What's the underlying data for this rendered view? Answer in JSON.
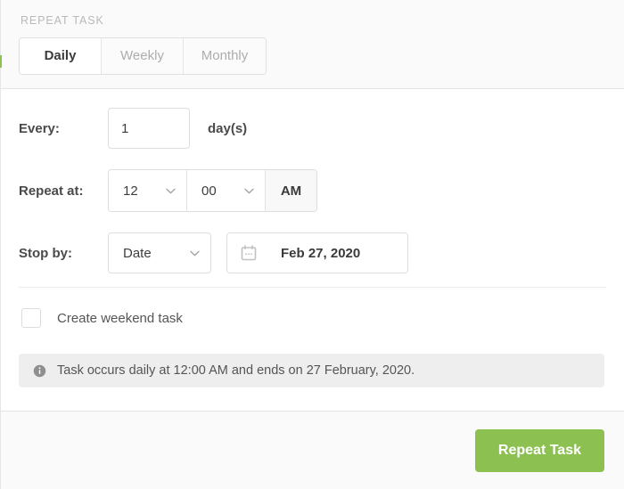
{
  "header": {
    "title": "REPEAT TASK",
    "tabs": [
      {
        "label": "Daily",
        "active": true
      },
      {
        "label": "Weekly",
        "active": false
      },
      {
        "label": "Monthly",
        "active": false
      }
    ]
  },
  "form": {
    "every": {
      "label": "Every:",
      "value": "1",
      "placeholder": "1",
      "suffix": "day(s)"
    },
    "repeat_at": {
      "label": "Repeat at:",
      "hour": "12",
      "minute": "00",
      "meridiem": "AM"
    },
    "stop_by": {
      "label": "Stop by:",
      "mode": "Date",
      "date": "Feb 27, 2020"
    },
    "weekend_task": {
      "label": "Create weekend task",
      "checked": false
    }
  },
  "info": {
    "icon": "info-circle-icon",
    "message": "Task occurs daily at 12:00 AM and ends on 27 February, 2020."
  },
  "footer": {
    "submit_label": "Repeat Task"
  },
  "colors": {
    "accent": "#8cc152",
    "panel_bg": "#ffffff",
    "header_bg": "#fafafa",
    "info_bg": "#eeeeee",
    "border": "#dedede",
    "label_text": "#4a4a4a",
    "muted_text": "#adadad"
  }
}
